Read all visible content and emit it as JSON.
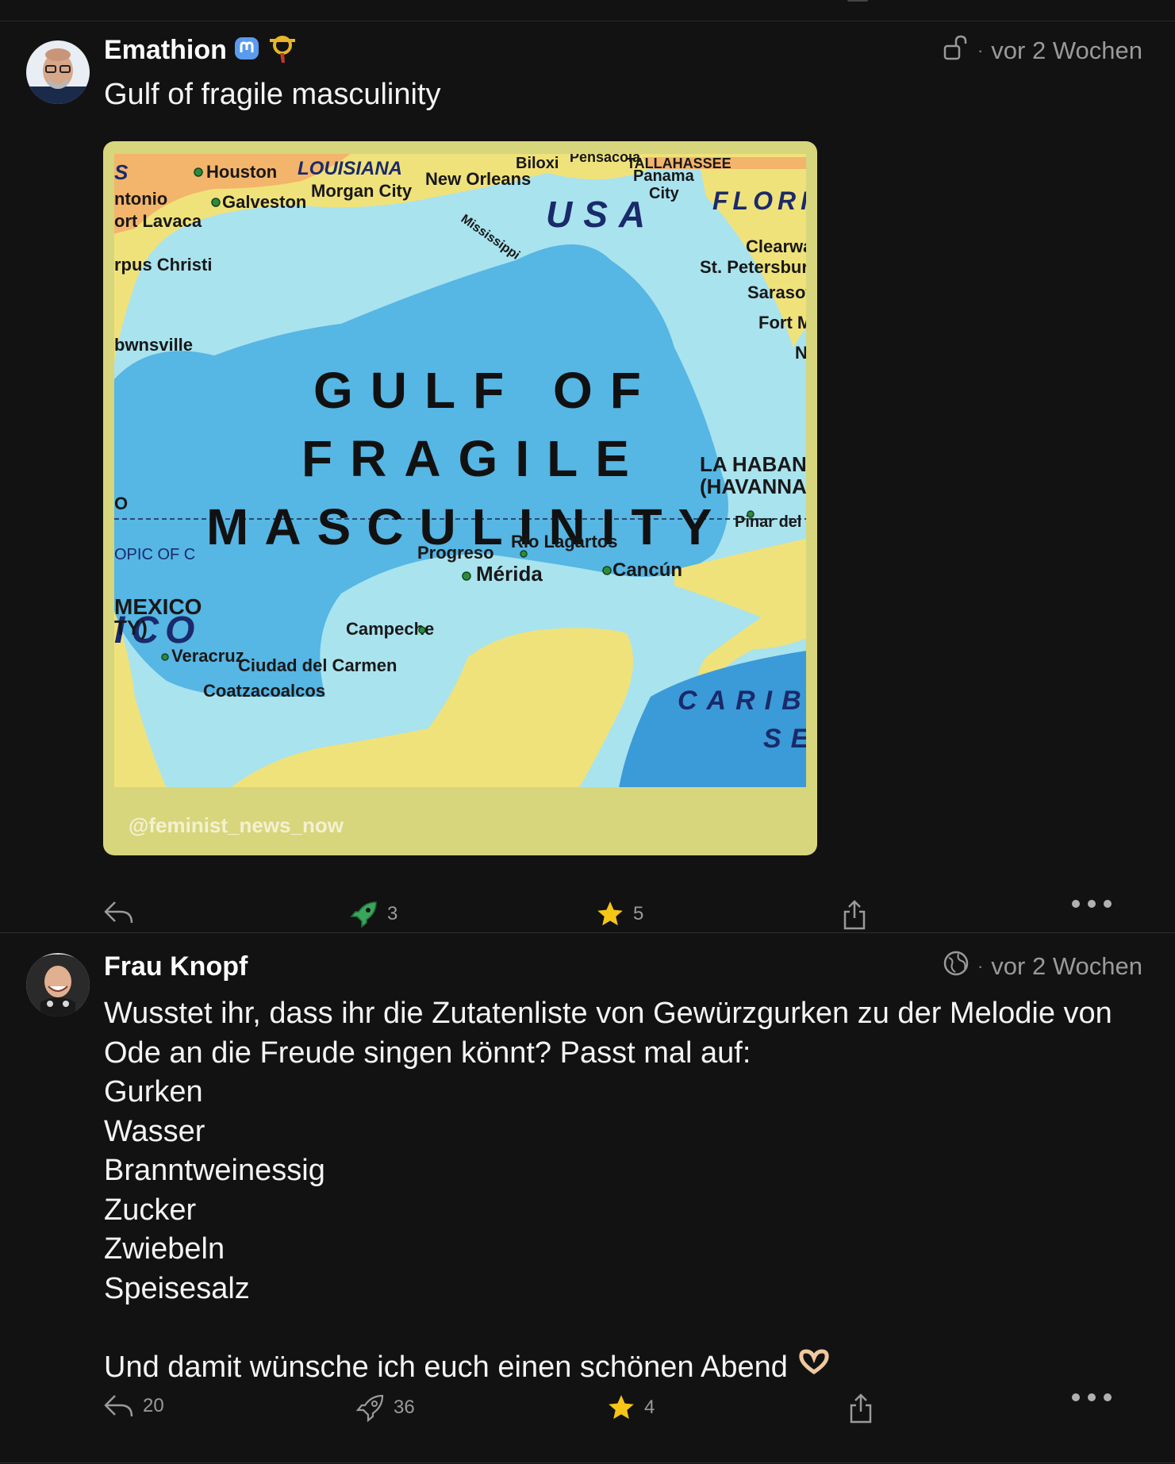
{
  "posts": [
    {
      "author": "Emathion",
      "visibility_icon": "unlock-icon",
      "time": "vor 2 Wochen",
      "text": "Gulf of fragile masculinity",
      "media": {
        "watermark": "@feminist_news_now",
        "map_labels": {
          "headline_1": "GULF OF",
          "headline_2": "FRAGILE",
          "headline_3": "MASCULINITY",
          "usa": "USA",
          "flori": "FLORI",
          "louisiana": "LOUISIANA",
          "tallahassee": "TALLAHASSEE",
          "houston": "Houston",
          "galveston": "Galveston",
          "morgan_city": "Morgan City",
          "new_orleans": "New Orleans",
          "biloxi": "Biloxi",
          "pensacola": "Pensacola",
          "panama": "Panama",
          "city": "City",
          "mississippi": "Mississippi",
          "ntonio": "ntonio",
          "ort_lavaca": "ort Lavaca",
          "us": "S",
          "rpus_christi": "rpus Christi",
          "bwnsville": "bwnsville",
          "clearwa": "Clearwa",
          "st_petersburg": "St. Petersburg",
          "sarasot": "Sarasot",
          "fort_m": "Fort M",
          "n": "N",
          "tropic": "OPIC OF C",
          "la_haban": "LA HABAN",
          "havanna": "(HAVANNA",
          "pinar": "Pinar del R",
          "o": "O",
          "ico": "ICO",
          "mexico": "MEXICO",
          "ty": "TY)",
          "progreso": "Progreso",
          "rio_lagartos": "Rio Lagartos",
          "merida": "Mérida",
          "cancun": "Cancún",
          "campeche": "Campeche",
          "veracruz": "Veracruz",
          "ciudad_del_carmen": "Ciudad del Carmen",
          "coatzacoalcos": "Coatzacoalcos",
          "carib": "CARIB",
          "se": "SE"
        }
      },
      "actions": {
        "reply": "",
        "boost": "3",
        "favourite": "5"
      }
    },
    {
      "author": "Frau Knopf",
      "visibility_icon": "globe-icon",
      "time": "vor 2 Wochen",
      "lines": [
        "Wusstet ihr, dass ihr die Zutatenliste von Gewürzgurken zu der Melodie von",
        "Ode an die Freude singen könnt? Passt mal auf:",
        "Gurken",
        "Wasser",
        "Branntweinessig",
        "Zucker",
        "Zwiebeln",
        "Speisesalz",
        "",
        "Und damit wünsche ich euch einen schönen Abend"
      ],
      "actions": {
        "reply": "20",
        "boost": "36",
        "favourite": "4"
      }
    }
  ],
  "colors": {
    "background": "#121212",
    "star": "#f5c518",
    "boost_active": "#3aa55c",
    "mastodon": "#5a9bf0"
  }
}
